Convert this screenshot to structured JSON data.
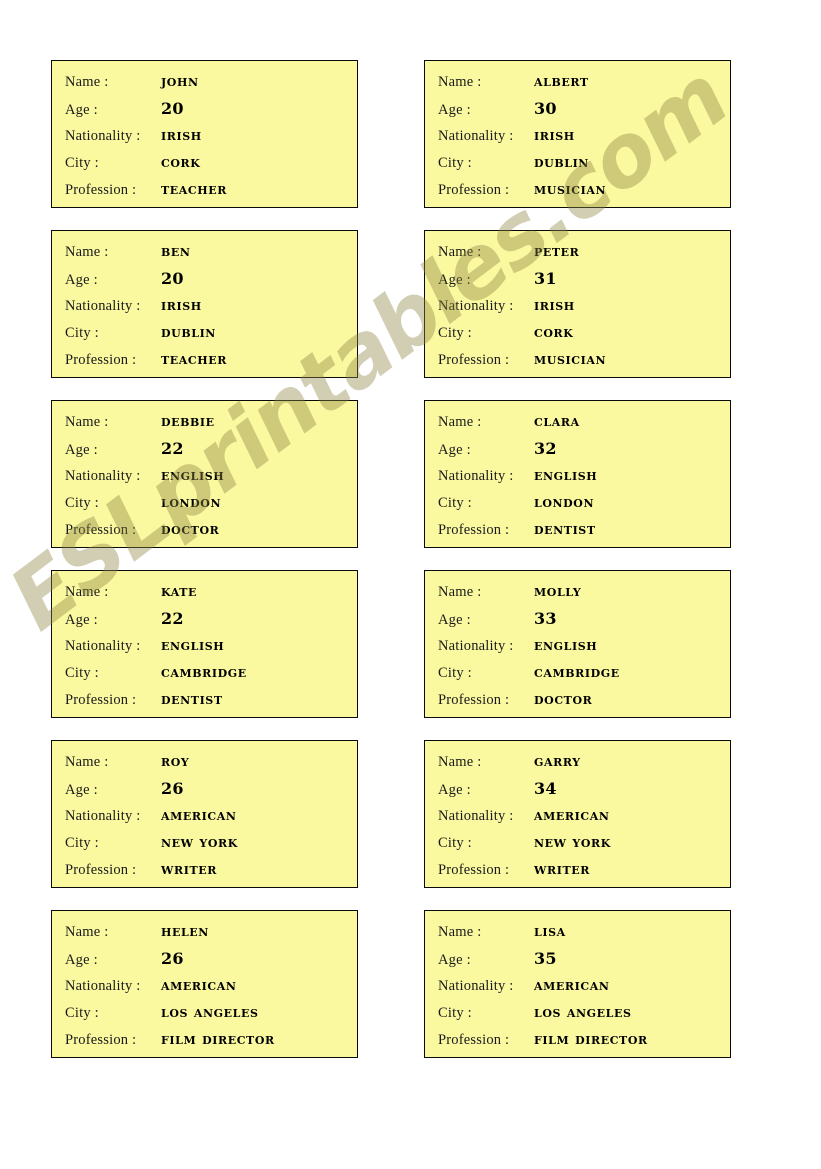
{
  "page": {
    "background_color": "#ffffff",
    "card_color": "#fbf9a0",
    "card_border_color": "#0a0a0a",
    "text_color": "#000000"
  },
  "watermark": {
    "text": "ESLprintables.com",
    "color": "#8c8440"
  },
  "labels": {
    "name": "Name :",
    "age": "Age :",
    "nationality": "Nationality :",
    "city": "City :",
    "profession": "Profession :"
  },
  "cards": [
    {
      "name": "John",
      "age": "20",
      "nationality": "Irish",
      "city": "Cork",
      "profession": "Teacher"
    },
    {
      "name": "Albert",
      "age": "30",
      "nationality": "Irish",
      "city": "Dublin",
      "profession": "Musician"
    },
    {
      "name": "Ben",
      "age": "20",
      "nationality": "Irish",
      "city": "Dublin",
      "profession": "Teacher"
    },
    {
      "name": "Peter",
      "age": "31",
      "nationality": "Irish",
      "city": "Cork",
      "profession": "Musician"
    },
    {
      "name": "Debbie",
      "age": "22",
      "nationality": "English",
      "city": "London",
      "profession": "Doctor"
    },
    {
      "name": "Clara",
      "age": "32",
      "nationality": "English",
      "city": "London",
      "profession": "Dentist"
    },
    {
      "name": "Kate",
      "age": "22",
      "nationality": "English",
      "city": "Cambridge",
      "profession": "Dentist"
    },
    {
      "name": "Molly",
      "age": "33",
      "nationality": "English",
      "city": "Cambridge",
      "profession": "Doctor"
    },
    {
      "name": "Roy",
      "age": "26",
      "nationality": "American",
      "city": "New York",
      "profession": "Writer"
    },
    {
      "name": "Garry",
      "age": "34",
      "nationality": "American",
      "city": "New York",
      "profession": "Writer"
    },
    {
      "name": "Helen",
      "age": "26",
      "nationality": "American",
      "city": "Los Angeles",
      "profession": "Film director"
    },
    {
      "name": "Lisa",
      "age": "35",
      "nationality": "American",
      "city": "Los Angeles",
      "profession": "Film director"
    }
  ]
}
